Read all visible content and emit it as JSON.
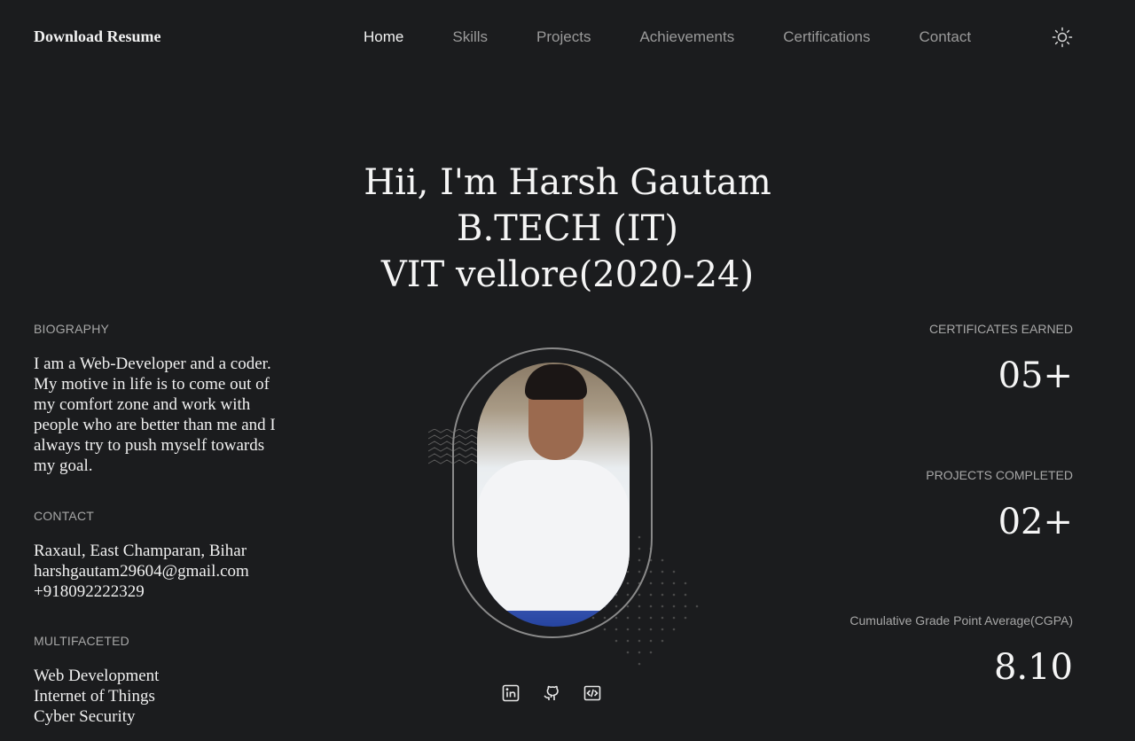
{
  "header": {
    "brand": "Download Resume",
    "nav": [
      "Home",
      "Skills",
      "Projects",
      "Achievements",
      "Certifications",
      "Contact"
    ],
    "theme_icon": "sun-icon"
  },
  "hero": {
    "line1": "Hii, I'm Harsh Gautam",
    "line2": "B.TECH (IT)",
    "line3": "VIT vellore(2020-24)"
  },
  "biography": {
    "label": "BIOGRAPHY",
    "text": "I am a Web-Developer and a coder. My motive in life is to come out of my comfort zone and work with people who are better than me and I always try to push myself towards my goal."
  },
  "contact": {
    "label": "CONTACT",
    "address": "Raxaul, East Champaran, Bihar",
    "email": "harshgautam29604@gmail.com",
    "phone": "+918092222329"
  },
  "multifaceted": {
    "label": "MULTIFACETED",
    "items": [
      "Web Development",
      "Internet of Things",
      "Cyber Security"
    ]
  },
  "stats": [
    {
      "label": "CERTIFICATES EARNED",
      "value": "05+"
    },
    {
      "label": "PROJECTS COMPLETED",
      "value": "02+"
    },
    {
      "label": "Cumulative Grade Point Average(CGPA)",
      "value": "8.10"
    }
  ],
  "socials": [
    "linkedin-icon",
    "github-icon",
    "code-icon"
  ],
  "colors": {
    "background": "#1b1c1e",
    "text": "#f0f0f0",
    "muted": "#a7a7a7"
  }
}
